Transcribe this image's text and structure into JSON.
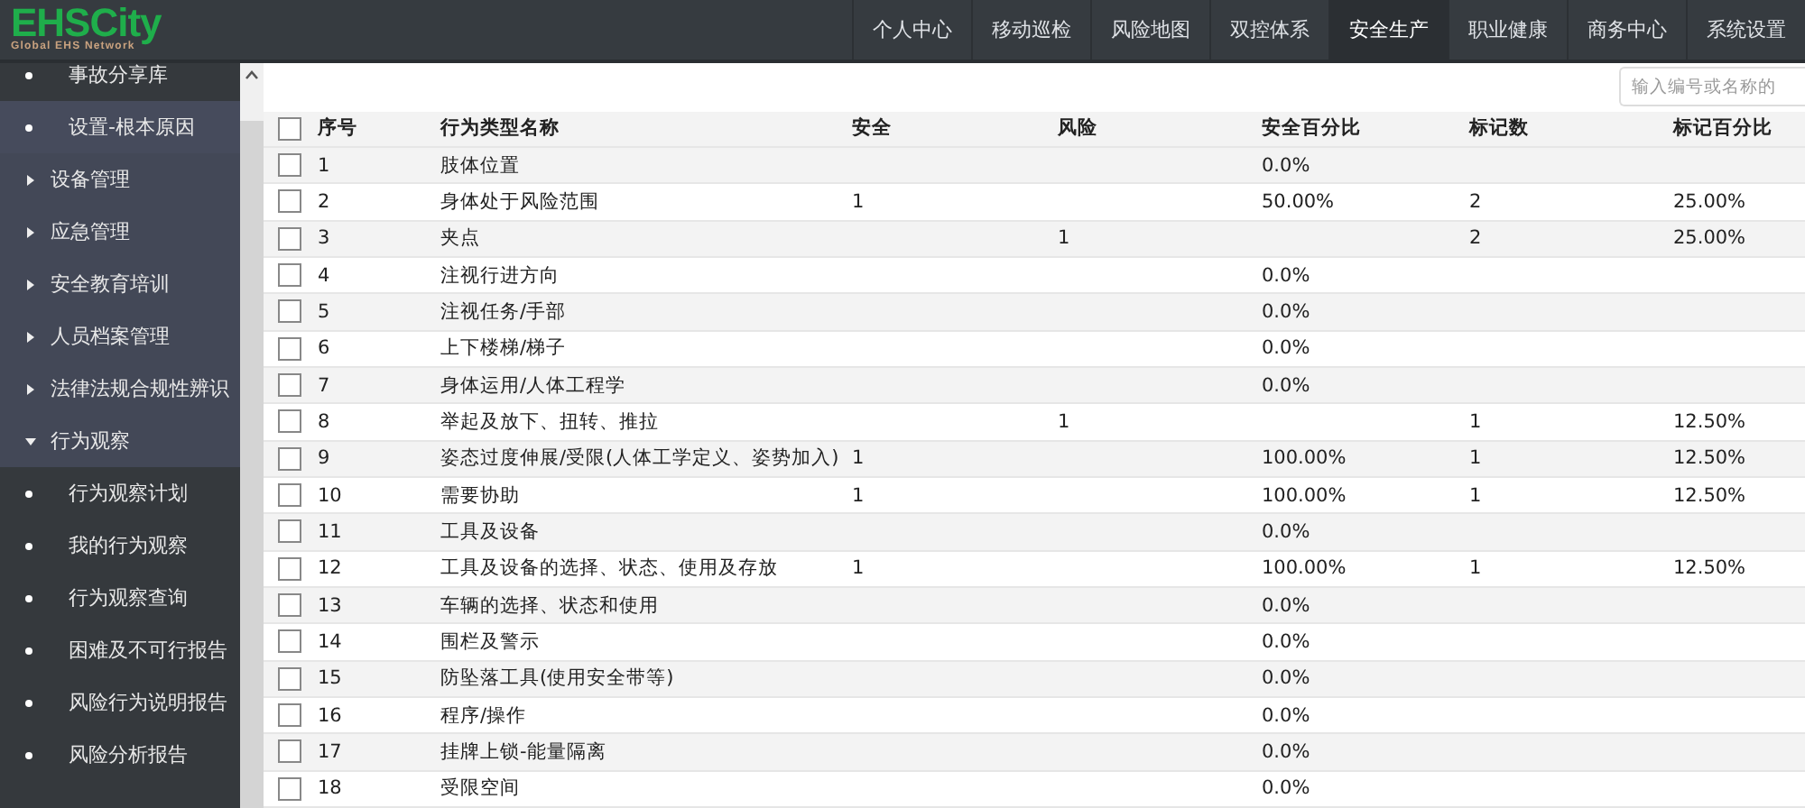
{
  "logo": {
    "name": "EHSCity",
    "tagline": "Global EHS Network"
  },
  "nav": [
    {
      "label": "个人中心",
      "selected": false
    },
    {
      "label": "移动巡检",
      "selected": false
    },
    {
      "label": "风险地图",
      "selected": false
    },
    {
      "label": "双控体系",
      "selected": false
    },
    {
      "label": "安全生产",
      "selected": true
    },
    {
      "label": "职业健康",
      "selected": false
    },
    {
      "label": "商务中心",
      "selected": false
    },
    {
      "label": "系统设置",
      "selected": false
    }
  ],
  "sidebar": {
    "items": [
      {
        "kind": "leaf",
        "label": "事故分享库",
        "selected": false
      },
      {
        "kind": "leaf",
        "label": "设置-根本原因",
        "selected": true
      },
      {
        "kind": "group",
        "label": "设备管理",
        "expanded": false
      },
      {
        "kind": "group",
        "label": "应急管理",
        "expanded": false
      },
      {
        "kind": "group",
        "label": "安全教育培训",
        "expanded": false
      },
      {
        "kind": "group",
        "label": "人员档案管理",
        "expanded": false
      },
      {
        "kind": "group",
        "label": "法律法规合规性辨识",
        "expanded": false
      },
      {
        "kind": "group",
        "label": "行为观察",
        "expanded": true,
        "children": [
          {
            "kind": "leaf",
            "label": "行为观察计划",
            "selected": false
          },
          {
            "kind": "leaf",
            "label": "我的行为观察",
            "selected": false
          },
          {
            "kind": "leaf",
            "label": "行为观察查询",
            "selected": false
          },
          {
            "kind": "leaf",
            "label": "困难及不可行报告",
            "selected": false
          },
          {
            "kind": "leaf",
            "label": "风险行为说明报告",
            "selected": false
          },
          {
            "kind": "leaf",
            "label": "风险分析报告",
            "selected": false
          }
        ]
      }
    ]
  },
  "search": {
    "placeholder": "输入编号或名称的"
  },
  "table": {
    "header_checked": false,
    "columns": [
      "序号",
      "行为类型名称",
      "安全",
      "风险",
      "安全百分比",
      "标记数",
      "标记百分比"
    ],
    "rows": [
      {
        "checked": false,
        "cells": [
          "1",
          "肢体位置",
          "",
          "",
          "0.0%",
          "",
          ""
        ]
      },
      {
        "checked": false,
        "cells": [
          "2",
          "身体处于风险范围",
          "1",
          "",
          "50.00%",
          "2",
          "25.00%"
        ]
      },
      {
        "checked": false,
        "cells": [
          "3",
          "夹点",
          "",
          "1",
          "",
          "2",
          "25.00%"
        ]
      },
      {
        "checked": false,
        "cells": [
          "4",
          "注视行进方向",
          "",
          "",
          "0.0%",
          "",
          ""
        ]
      },
      {
        "checked": false,
        "cells": [
          "5",
          "注视任务/手部",
          "",
          "",
          "0.0%",
          "",
          ""
        ]
      },
      {
        "checked": false,
        "cells": [
          "6",
          "上下楼梯/梯子",
          "",
          "",
          "0.0%",
          "",
          ""
        ]
      },
      {
        "checked": false,
        "cells": [
          "7",
          "身体运用/人体工程学",
          "",
          "",
          "0.0%",
          "",
          ""
        ]
      },
      {
        "checked": false,
        "cells": [
          "8",
          "举起及放下、扭转、推拉",
          "",
          "1",
          "",
          "1",
          "12.50%"
        ]
      },
      {
        "checked": false,
        "cells": [
          "9",
          "姿态过度伸展/受限(人体工学定义、姿势加入)",
          "1",
          "",
          "100.00%",
          "1",
          "12.50%"
        ]
      },
      {
        "checked": false,
        "cells": [
          "10",
          "需要协助",
          "1",
          "",
          "100.00%",
          "1",
          "12.50%"
        ]
      },
      {
        "checked": false,
        "cells": [
          "11",
          "工具及设备",
          "",
          "",
          "0.0%",
          "",
          ""
        ]
      },
      {
        "checked": false,
        "cells": [
          "12",
          "工具及设备的选择、状态、使用及存放",
          "1",
          "",
          "100.00%",
          "1",
          "12.50%"
        ]
      },
      {
        "checked": false,
        "cells": [
          "13",
          "车辆的选择、状态和使用",
          "",
          "",
          "0.0%",
          "",
          ""
        ]
      },
      {
        "checked": false,
        "cells": [
          "14",
          "围栏及警示",
          "",
          "",
          "0.0%",
          "",
          ""
        ]
      },
      {
        "checked": false,
        "cells": [
          "15",
          "防坠落工具(使用安全带等)",
          "",
          "",
          "0.0%",
          "",
          ""
        ]
      },
      {
        "checked": false,
        "cells": [
          "16",
          "程序/操作",
          "",
          "",
          "0.0%",
          "",
          ""
        ]
      },
      {
        "checked": false,
        "cells": [
          "17",
          "挂牌上锁-能量隔离",
          "",
          "",
          "0.0%",
          "",
          ""
        ]
      },
      {
        "checked": false,
        "cells": [
          "18",
          "受限空间",
          "",
          "",
          "0.0%",
          "",
          ""
        ]
      }
    ]
  }
}
